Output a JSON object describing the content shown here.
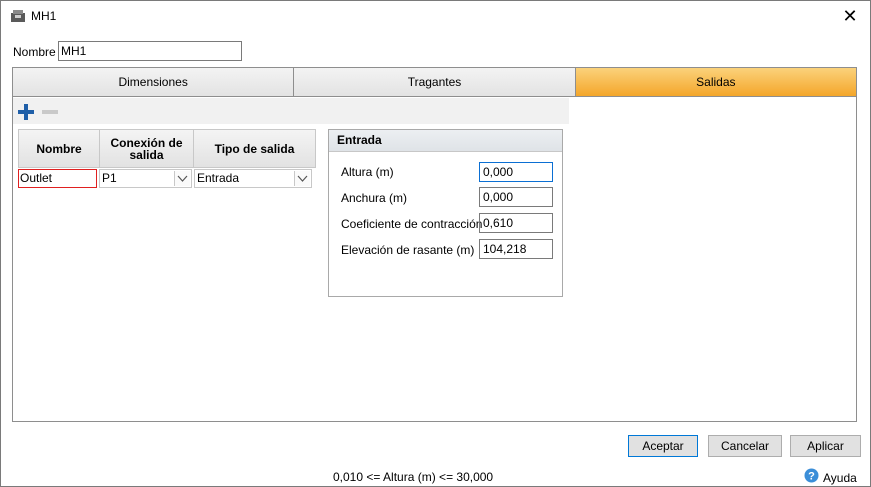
{
  "window": {
    "title": "MH1",
    "app_icon": "manhole-icon",
    "close_icon": "close-icon"
  },
  "name_field": {
    "label": "Nombre",
    "value": "MH1"
  },
  "tabs": [
    {
      "label": "Dimensiones",
      "active": false
    },
    {
      "label": "Tragantes",
      "active": false
    },
    {
      "label": "Salidas",
      "active": true
    }
  ],
  "toolbar": {
    "add_icon": "plus-icon",
    "remove_icon": "minus-icon"
  },
  "outlets_grid": {
    "headers": [
      "Nombre",
      "Conexión de salida",
      "Tipo de salida"
    ],
    "rows": [
      {
        "nombre": "Outlet",
        "conexion": "P1",
        "tipo": "Entrada"
      }
    ]
  },
  "entrada": {
    "header": "Entrada",
    "fields": [
      {
        "label": "Altura (m)",
        "value": "0,000"
      },
      {
        "label": "Anchura (m)",
        "value": "0,000"
      },
      {
        "label": "Coeficiente de contracción",
        "value": "0,610"
      },
      {
        "label": "Elevación de rasante (m)",
        "value": "104,218"
      }
    ]
  },
  "buttons": {
    "accept": "Aceptar",
    "cancel": "Cancelar",
    "apply": "Aplicar"
  },
  "status": {
    "text": "0,010 <= Altura (m) <= 30,000"
  },
  "help": {
    "label": "Ayuda",
    "icon": "help-icon"
  },
  "colors": {
    "active_tab": "#f4a62a",
    "accent": "#0078d7",
    "invalid_border": "#e02020"
  }
}
